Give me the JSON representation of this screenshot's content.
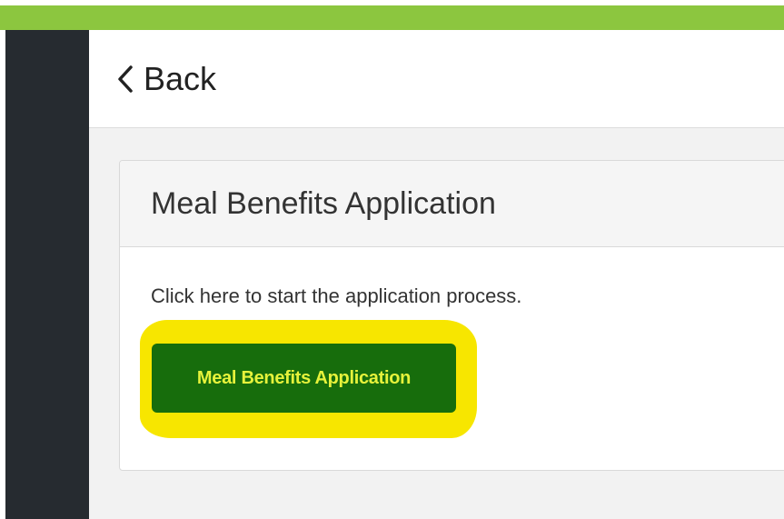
{
  "header": {
    "back_label": "Back",
    "back_icon": "chevron-left-icon"
  },
  "card": {
    "title": "Meal Benefits Application",
    "instructions": "Click here to start the application process.",
    "button_label": "Meal Benefits Application"
  },
  "colors": {
    "top_bar": "#8cc63f",
    "sidebar": "#262b30",
    "button_bg": "#176d0c",
    "button_text": "#e6f23b",
    "highlight": "#f7e600"
  }
}
